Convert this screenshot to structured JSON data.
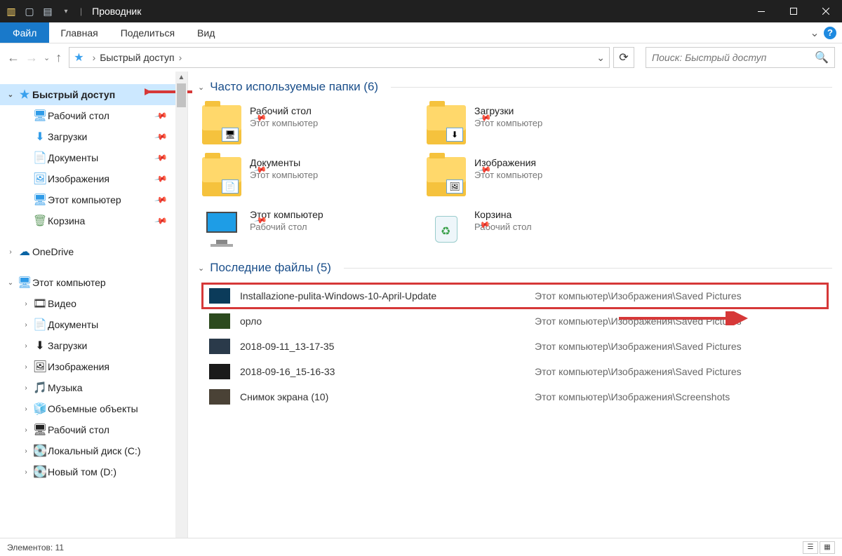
{
  "window": {
    "title": "Проводник"
  },
  "ribbon": {
    "file": "Файл",
    "tabs": [
      "Главная",
      "Поделиться",
      "Вид"
    ]
  },
  "address": {
    "root": "Быстрый доступ"
  },
  "search": {
    "placeholder": "Поиск: Быстрый доступ"
  },
  "sidebar": {
    "quick_access": "Быстрый доступ",
    "quick_items": [
      {
        "label": "Рабочий стол",
        "icon": "🖥",
        "color": "#2f9be8"
      },
      {
        "label": "Загрузки",
        "icon": "⬇",
        "color": "#2f9be8"
      },
      {
        "label": "Документы",
        "icon": "📄",
        "color": "#8a8a8a"
      },
      {
        "label": "Изображения",
        "icon": "🖼",
        "color": "#2f9be8"
      },
      {
        "label": "Этот компьютер",
        "icon": "🖥",
        "color": "#2f9be8"
      },
      {
        "label": "Корзина",
        "icon": "🗑",
        "color": "#6aa06a"
      }
    ],
    "onedrive": "OneDrive",
    "this_pc": "Этот компьютер",
    "pc_items": [
      {
        "label": "Видео",
        "icon": "🎞"
      },
      {
        "label": "Документы",
        "icon": "📄"
      },
      {
        "label": "Загрузки",
        "icon": "⬇"
      },
      {
        "label": "Изображения",
        "icon": "🖼"
      },
      {
        "label": "Музыка",
        "icon": "🎵"
      },
      {
        "label": "Объемные объекты",
        "icon": "🧊"
      },
      {
        "label": "Рабочий стол",
        "icon": "🖥"
      },
      {
        "label": "Локальный диск (C:)",
        "icon": "💽"
      },
      {
        "label": "Новый том (D:)",
        "icon": "💽"
      }
    ]
  },
  "content": {
    "frequent_header": "Часто используемые папки (6)",
    "recent_header": "Последние файлы (5)",
    "folders": [
      {
        "name": "Рабочий стол",
        "sub": "Этот компьютер",
        "overlay": "🖥"
      },
      {
        "name": "Загрузки",
        "sub": "Этот компьютер",
        "overlay": "⬇"
      },
      {
        "name": "Документы",
        "sub": "Этот компьютер",
        "overlay": "📄"
      },
      {
        "name": "Изображения",
        "sub": "Этот компьютер",
        "overlay": "🖼"
      },
      {
        "name": "Этот компьютер",
        "sub": "Рабочий стол",
        "type": "pc"
      },
      {
        "name": "Корзина",
        "sub": "Рабочий стол",
        "type": "bin"
      }
    ],
    "recent": [
      {
        "name": "Installazione-pulita-Windows-10-April-Update",
        "path": "Этот компьютер\\Изображения\\Saved Pictures",
        "hl": true,
        "thumb": "#0b3b5a"
      },
      {
        "name": "орло",
        "path": "Этот компьютер\\Изображения\\Saved Pictures",
        "thumb": "#2c4a1e"
      },
      {
        "name": "2018-09-11_13-17-35",
        "path": "Этот компьютер\\Изображения\\Saved Pictures",
        "thumb": "#2a3a4a"
      },
      {
        "name": "2018-09-16_15-16-33",
        "path": "Этот компьютер\\Изображения\\Saved Pictures",
        "thumb": "#1a1a1a"
      },
      {
        "name": "Снимок экрана (10)",
        "path": "Этот компьютер\\Изображения\\Screenshots",
        "thumb": "#4a4236"
      }
    ]
  },
  "status": {
    "count": "Элементов: 11"
  }
}
